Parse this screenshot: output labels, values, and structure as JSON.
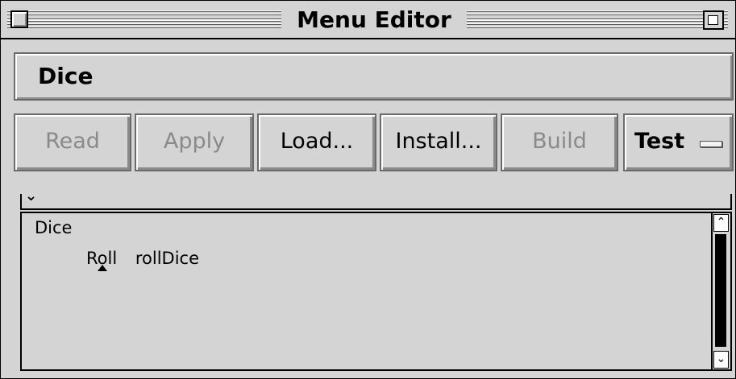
{
  "window": {
    "title": "Menu Editor"
  },
  "menu_name": {
    "value": "Dice"
  },
  "toolbar": {
    "buttons": [
      {
        "label": "Read",
        "enabled": false
      },
      {
        "label": "Apply",
        "enabled": false
      },
      {
        "label": "Load...",
        "enabled": true
      },
      {
        "label": "Install...",
        "enabled": true
      },
      {
        "label": "Build",
        "enabled": false
      }
    ],
    "test_popup": {
      "label": "Test"
    }
  },
  "outline": {
    "collapse_glyph": "⌄",
    "menu_title": "Dice",
    "items": [
      {
        "label": "Roll",
        "action": "rollDice",
        "selected": true
      }
    ]
  },
  "scrollbar": {
    "up_glyph": "⌃",
    "down_glyph": "⌄"
  },
  "icons": {
    "close": "close-box-icon",
    "zoom": "zoom-box-icon",
    "popup": "popup-indicator-icon",
    "marker": "triangle-up-icon"
  }
}
